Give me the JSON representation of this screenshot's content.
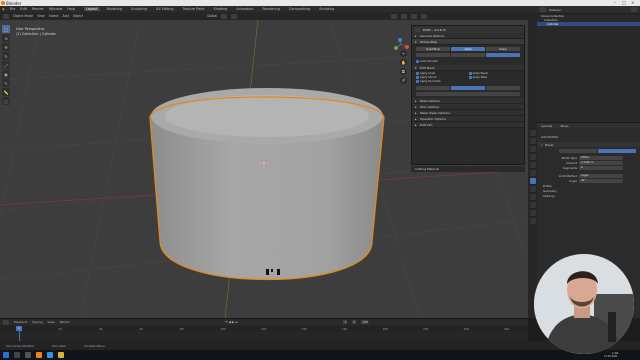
{
  "titlebar": {
    "title": "Blender"
  },
  "menu": {
    "items": [
      "File",
      "Edit",
      "Render",
      "Window",
      "Help"
    ],
    "workspaces": [
      "Layout",
      "Modeling",
      "Sculpting",
      "UV Editing",
      "Texture Paint",
      "Shading",
      "Animation",
      "Rendering",
      "Compositing",
      "Scripting"
    ],
    "active_workspace": "Layout",
    "scene": "Scene",
    "view_layer": "ViewLayer"
  },
  "viewport": {
    "mode": "Object Mode",
    "header_items": [
      "View",
      "Select",
      "Add",
      "Object"
    ],
    "global_label": "Global",
    "info_line1": "User Perspective",
    "info_line2": "(1) Collection | Cylinder"
  },
  "remesh_panel": {
    "title": "RQfix - 4.0.8 r5",
    "sections": [
      "General Options",
      "Misc Options",
      "Mesh Clean Options",
      "Operator Options"
    ],
    "open_section": "Modes/Map",
    "mode_buttons": [
      "Quadriflow",
      "Voxel",
      "Sharp"
    ],
    "check_label": "Auto Smooth",
    "checkboxes": [
      "Apply Scale",
      "Apply Bevel",
      "Apply Shrink",
      "Apply Weld",
      "Apply Decimate"
    ],
    "edit_label": "Edit Mesh",
    "bottom_sections": [
      "Bake Options",
      "Skin Options",
      "Mesh Clean Options",
      "Operator Options",
      "Edit Info"
    ],
    "footer": "Cutting Material"
  },
  "outliner": {
    "title": "Outliner",
    "items": [
      "Scene Collection",
      "Collection",
      "Cylinder"
    ]
  },
  "properties": {
    "tabs": [
      "Cylinder",
      "Bevel"
    ],
    "section": "Add Modifier",
    "modifier_name": "Bevel",
    "fields": [
      {
        "label": "Width Type",
        "value": "Offset"
      },
      {
        "label": "Amount",
        "value": "0.1346 m"
      },
      {
        "label": "Segments",
        "value": "6"
      },
      {
        "label": "Limit Method",
        "value": "Angle"
      },
      {
        "label": "Angle",
        "value": "30°"
      }
    ],
    "subsections": [
      "Profile",
      "Geometry",
      "Shading"
    ]
  },
  "timeline": {
    "header": [
      "Playback",
      "Keying",
      "View",
      "Marker"
    ],
    "current_frame": "1",
    "start": "1",
    "end": "250",
    "ticks": [
      "0",
      "20",
      "40",
      "60",
      "80",
      "100",
      "120",
      "140",
      "160",
      "180",
      "200",
      "220",
      "240"
    ]
  },
  "statusbar": {
    "items": [
      "Set Active Modifier",
      "Pan View",
      "Context Menu"
    ]
  },
  "taskbar": {
    "time": "1:04",
    "date": "27.09.2021"
  },
  "colors": {
    "accent": "#4a74b5",
    "selection_outline": "#e8861a",
    "viewport_bg": "#3d3d3d"
  }
}
